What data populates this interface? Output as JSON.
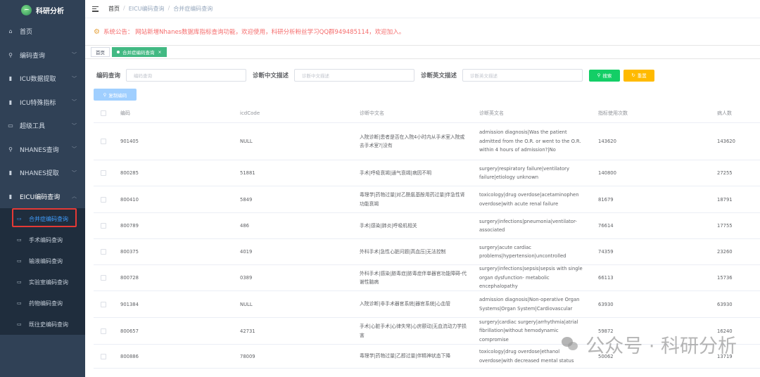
{
  "sidebar": {
    "title": "科研分析",
    "items": [
      {
        "label": "首页",
        "icon": "home-icon",
        "glyph": "⌂"
      },
      {
        "label": "编码查询",
        "icon": "search-icon",
        "glyph": "⚲"
      },
      {
        "label": "ICU数据提取",
        "icon": "bar-chart-icon",
        "glyph": "▮"
      },
      {
        "label": "ICU特殊指标",
        "icon": "bar-chart-icon",
        "glyph": "▮"
      },
      {
        "label": "超级工具",
        "icon": "monitor-icon",
        "glyph": "▭"
      },
      {
        "label": "NHANES查询",
        "icon": "search-icon",
        "glyph": "⚲"
      },
      {
        "label": "NHANES提取",
        "icon": "bar-chart-icon",
        "glyph": "▮"
      },
      {
        "label": "EICU编码查询",
        "icon": "bar-chart-icon",
        "glyph": "▮"
      }
    ],
    "subitems": [
      {
        "label": "合并症编码查询"
      },
      {
        "label": "手术编码查询"
      },
      {
        "label": "输液编码查询"
      },
      {
        "label": "实验室编码查询"
      },
      {
        "label": "药物编码查询"
      },
      {
        "label": "既往史编码查询"
      }
    ]
  },
  "breadcrumb": [
    "首页",
    "/",
    "EICU编码查询",
    "/",
    "合并症编码查询"
  ],
  "notice": "系统公告：  网站新增Nhanes数据库指标查询功能，欢迎使用，科研分析粉丝学习QQ群949485114，欢迎加入。",
  "tags": {
    "home": "首页",
    "active": "合并症编码查询",
    "close": "×"
  },
  "form": {
    "code_label": "编码查询",
    "code_placeholder": "编码查询",
    "cn_label": "诊断中文描述",
    "cn_placeholder": "诊断中文描述",
    "en_label": "诊断英文描述",
    "en_placeholder": "诊断英文描述",
    "search": "搜索",
    "reset": "重置",
    "export": "复制编码"
  },
  "table": {
    "headers": [
      "编码",
      "icdCode",
      "诊断中文名",
      "诊断英文名",
      "指标使用次数",
      "病人数"
    ],
    "rows": [
      {
        "code": "901405",
        "icd": "NULL",
        "cn": "入院诊断|患者是否在入院4小时内从手术室入院或去手术室?|没有",
        "en": "admission diagnosis|Was the patient admitted from the O.R. or went to the O.R. within 4 hours of admission?|No",
        "use": "143620",
        "pat": "143620"
      },
      {
        "code": "800285",
        "icd": "51881",
        "cn": "手术|呼吸衰竭|通气衰竭|病因不明",
        "en": "surgery|respiratory failure|ventilatory failure|etiology unknown",
        "use": "140800",
        "pat": "27255"
      },
      {
        "code": "800410",
        "icd": "5849",
        "cn": "毒理学|药物过量|对乙酰氨基酚用药过量|伴急性肾功能衰竭",
        "en": "toxicology|drug overdose|acetaminophen overdose|with acute renal failure",
        "use": "81679",
        "pat": "18791"
      },
      {
        "code": "800789",
        "icd": "486",
        "cn": "手术|感染|肺炎|呼吸机相关",
        "en": "surgery|infections|pneumonia|ventilator-associated",
        "use": "76614",
        "pat": "17755"
      },
      {
        "code": "800375",
        "icd": "4019",
        "cn": "外科手术|急性心脏问题|高血压|无法控制",
        "en": "surgery|acute cardiac problems|hypertension|uncontrolled",
        "use": "74359",
        "pat": "23260"
      },
      {
        "code": "800728",
        "icd": "0389",
        "cn": "外科手术|感染|脓毒症|脓毒症伴单器官功能障碍-代谢性脑病",
        "en": "surgery|infections|sepsis|sepsis with single organ dysfunction- metabolic encephalopathy",
        "use": "66113",
        "pat": "15736"
      },
      {
        "code": "901384",
        "icd": "NULL",
        "cn": "入院诊断|非手术器官系统|器官系统|心血管",
        "en": "admission diagnosis|Non-operative Organ Systems|Organ System|Cardiovascular",
        "use": "63930",
        "pat": "63930"
      },
      {
        "code": "800657",
        "icd": "42731",
        "cn": "手术|心脏手术|心律失常|心房颤动|无血流动力学损害",
        "en": "surgery|cardiac surgery|arrhythmia|atrial fibrillation|without hemodynamic compromise",
        "use": "59872",
        "pat": "16240"
      },
      {
        "code": "800886",
        "icd": "78009",
        "cn": "毒理学|药物过量|乙醇过量|伴精神状态下降",
        "en": "toxicology|drug overdose|ethanol overdose|with decreased mental status",
        "use": "50062",
        "pat": "13719"
      }
    ]
  },
  "watermark": "公众号 · 科研分析",
  "colors": {
    "sidebar_bg": "#304156",
    "active_tag": "#42b983",
    "search_btn": "#13ce66",
    "reset_btn": "#ffba00",
    "notice": "#f56c6c",
    "highlight": "#e53935"
  }
}
